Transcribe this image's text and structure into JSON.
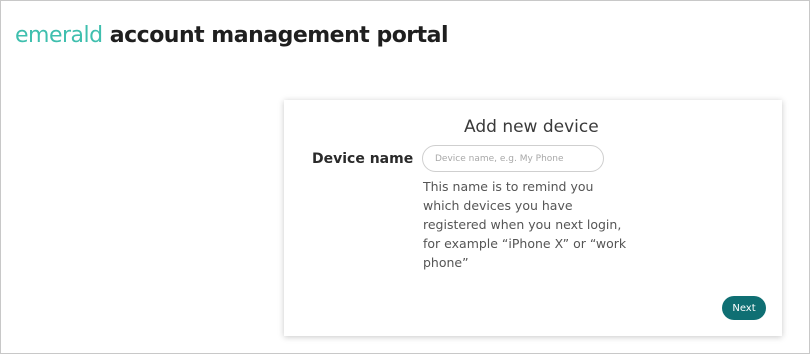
{
  "header": {
    "brand_light": "emerald",
    "brand_bold": " account management portal"
  },
  "card": {
    "title": "Add new device",
    "device_name": {
      "label": "Device name",
      "value": "",
      "placeholder": "Device name, e.g. My Phone",
      "help": "This name is to remind you which devices you have registered when you next login, for example “iPhone X” or “work phone”"
    },
    "next_label": "Next"
  },
  "colors": {
    "brand_accent": "#3fbfae",
    "primary_button": "#0f6f73"
  }
}
